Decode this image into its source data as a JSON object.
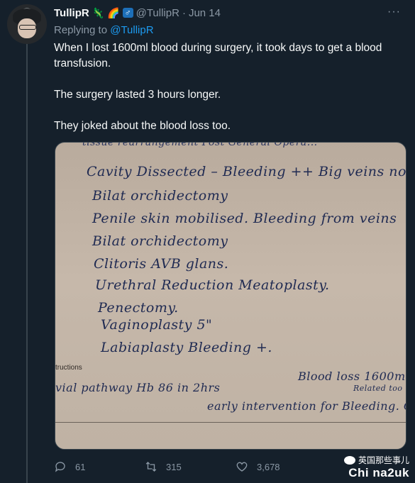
{
  "tweet": {
    "author_name": "TullipR",
    "badges": [
      "🦎",
      "🌈",
      "♂"
    ],
    "handle": "@TullipR",
    "separator": "·",
    "date": "Jun 14",
    "more_icon": "···",
    "replying_prefix": "Replying to",
    "replying_to": "@TullipR",
    "paragraphs": [
      "When I lost 1600ml blood during surgery, it took days to get a blood transfusion.",
      "The surgery lasted 3 hours longer.",
      "They joked about the blood loss too."
    ]
  },
  "photo": {
    "handwritten_lines": [
      "Cavity Dissected – Bleeding ++  Big veins  no rectal ...",
      "Bilat orchidectomy",
      "Penile skin mobilised.  Bleeding from veins",
      "Bilat orchidectomy",
      "Clitoris AVB glans.",
      "Urethral Reduction  Meatoplasty.",
      "Penectomy.",
      "Vaginoplasty  5\"",
      "Labiaplasty  Bleeding +.",
      "vial pathway  Hb 86 in 2hrs",
      "Blood loss 1600ml",
      "Related too",
      "early intervention for Bleeding. Call"
    ],
    "printed_label": "tructions",
    "top_partial": "tissue rearrangement   Post General Opera..."
  },
  "actions": {
    "replies": "61",
    "retweets": "315",
    "likes": "3,678"
  },
  "watermark": {
    "line1": "英国那些事儿",
    "line2": "Chi na2uk"
  },
  "colors": {
    "background": "#15202b",
    "text": "#f7f9f9",
    "muted": "#8b98a5",
    "link": "#1d9bf0",
    "ink": "#1f2a52"
  }
}
